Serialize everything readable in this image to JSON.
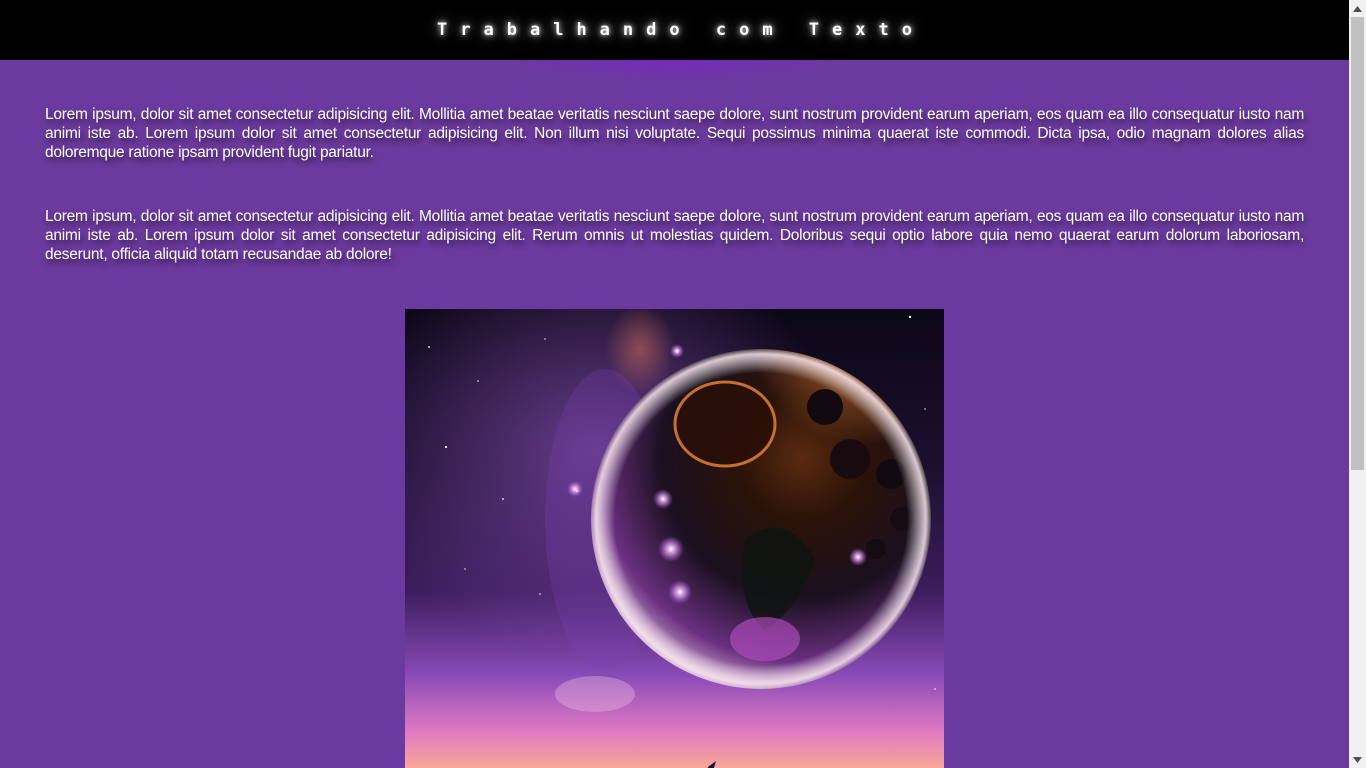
{
  "header": {
    "title": "Trabalhando com Texto"
  },
  "main": {
    "paragraphs": [
      "Lorem ipsum, dolor sit amet consectetur adipisicing elit. Mollitia amet beatae veritatis nesciunt saepe dolore, sunt nostrum provident earum aperiam, eos quam ea illo consequatur iusto nam animi iste ab. Lorem ipsum dolor sit amet consectetur adipisicing elit. Non illum nisi voluptate. Sequi possimus minima quaerat iste commodi. Dicta ipsa, odio magnam dolores alias doloremque ratione ipsam provident fugit pariatur.",
      "Lorem ipsum, dolor sit amet consectetur adipisicing elit. Mollitia amet beatae veritatis nesciunt saepe dolore, sunt nostrum provident earum aperiam, eos quam ea illo consequatur iusto nam animi iste ab. Lorem ipsum dolor sit amet consectetur adipisicing elit. Rerum omnis ut molestias quidem. Doloribus sequi optio labore quia nemo quaerat earum dolorum laboriosam, deserunt, officia aliquid totam recusandae ab dolore!"
    ],
    "image": {
      "subject": "moon-night-sky-illustration"
    }
  },
  "colors": {
    "page_background": "#6b3a9e",
    "header_background": "#000000",
    "text": "#ffffff"
  }
}
